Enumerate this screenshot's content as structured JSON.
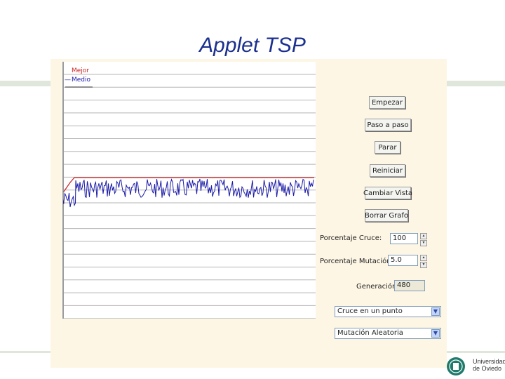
{
  "title": "Applet TSP",
  "legend": {
    "best": "Mejor",
    "average": "Medio"
  },
  "buttons": {
    "start": "Empezar",
    "step": "Paso a paso",
    "stop": "Parar",
    "reset": "Reiniciar",
    "change_view": "Cambiar Vista",
    "clear_graph": "Borrar Grafo"
  },
  "params": {
    "crossover_label": "Porcentaje Cruce:",
    "crossover_value": "100",
    "mutation_label": "Porcentaje Mutación:",
    "mutation_value": "5.0",
    "generation_label": "Generación",
    "generation_value": "480"
  },
  "selects": {
    "crossover_type": "Cruce en un punto",
    "mutation_type": "Mutación Aleatoria"
  },
  "university": {
    "line1": "Universidad",
    "line2": "de Oviedo"
  },
  "colors": {
    "title": "#1b2f8f",
    "best": "#cc2222",
    "average": "#1a1aa8",
    "panel": "#fdf6e4"
  }
}
